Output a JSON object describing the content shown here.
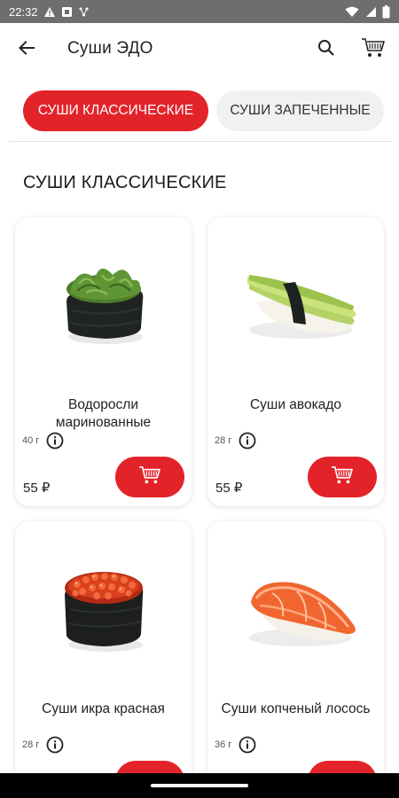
{
  "status_bar": {
    "time": "22:32",
    "icons": [
      "warning-icon",
      "media-icon",
      "network-icon",
      "wifi-icon",
      "signal-icon",
      "battery-icon"
    ]
  },
  "app_bar": {
    "title": "Суши ЭДО",
    "icons": [
      "back-arrow-icon",
      "search-icon",
      "cart-icon"
    ]
  },
  "tabs": [
    {
      "label": "СУШИ КЛАССИЧЕСКИЕ",
      "active": true
    },
    {
      "label": "СУШИ ЗАПЕЧЕННЫЕ",
      "active": false
    }
  ],
  "section": {
    "title": "СУШИ КЛАССИЧЕСКИЕ"
  },
  "products": [
    {
      "name": "Водоросли маринованные",
      "weight": "40 г",
      "price": "55 ₽"
    },
    {
      "name": "Суши авокадо",
      "weight": "28 г",
      "price": "55 ₽"
    },
    {
      "name": "Суши икра красная",
      "weight": "28 г",
      "price": ""
    },
    {
      "name": "Суши копченый лосось",
      "weight": "36 г",
      "price": ""
    }
  ],
  "colors": {
    "accent": "#e3232a",
    "tab_inactive_bg": "#f1f1f1",
    "status_bar": "#6e6e6e"
  }
}
